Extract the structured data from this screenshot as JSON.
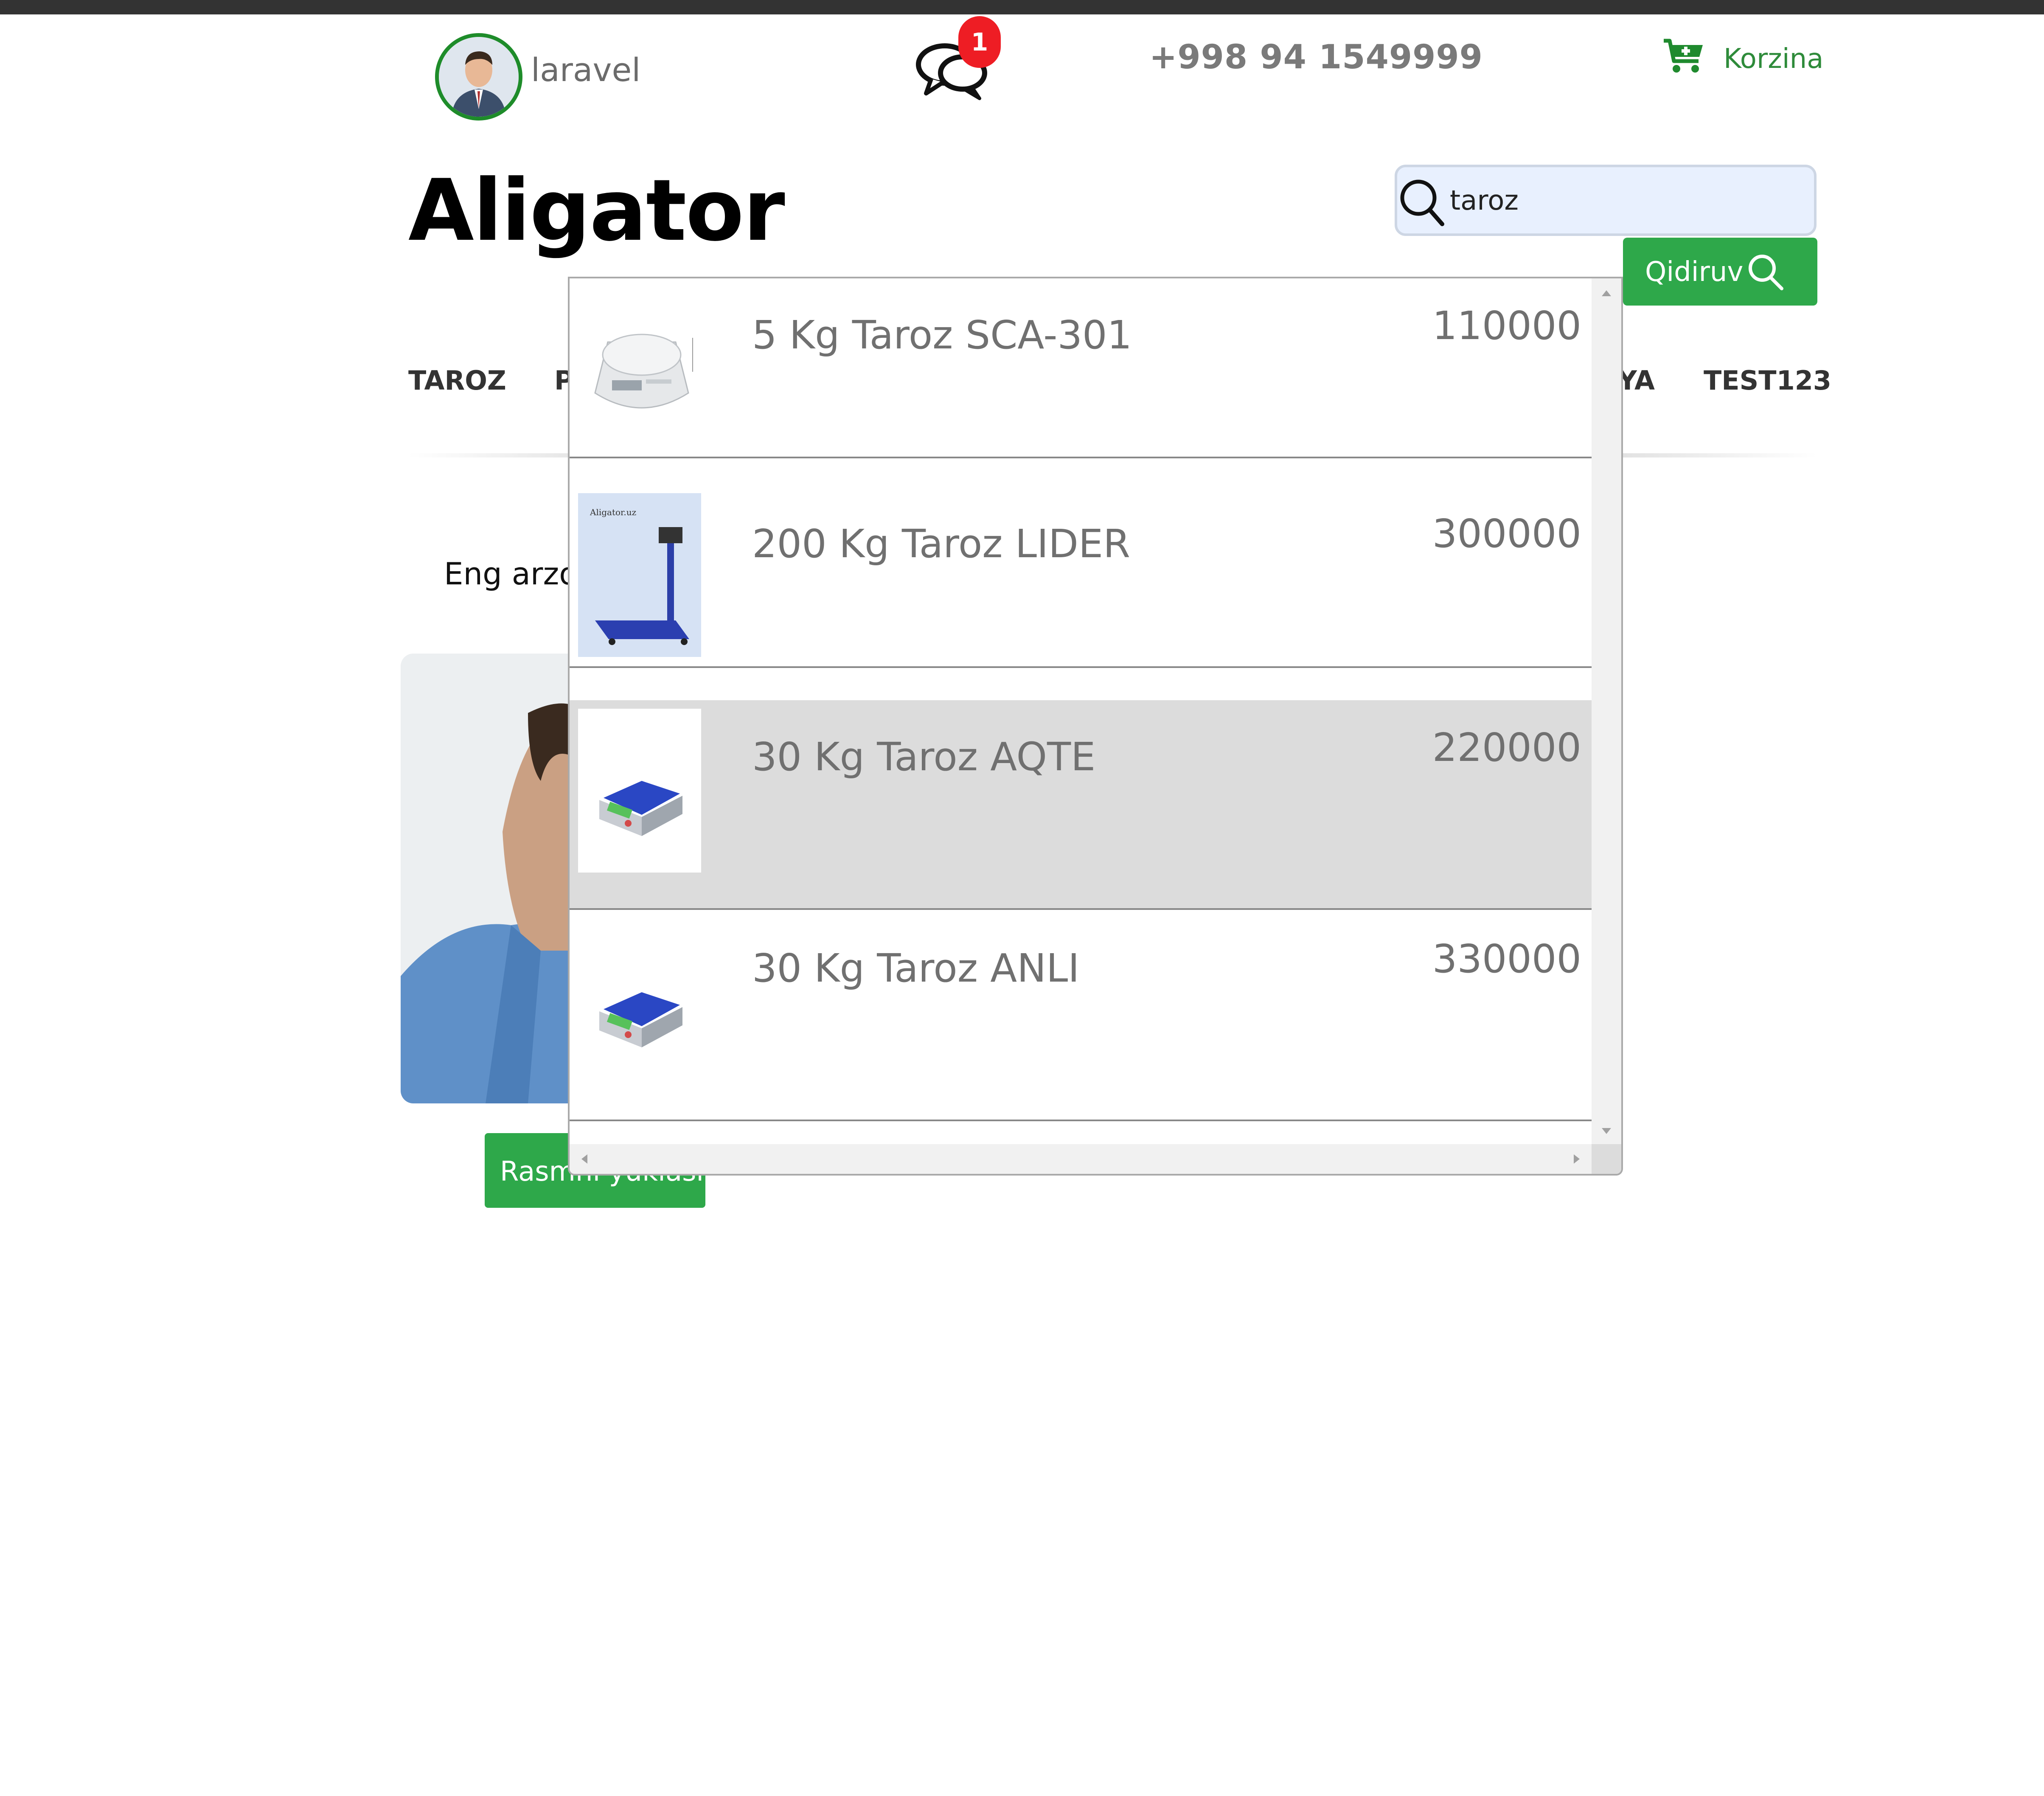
{
  "header": {
    "username": "laravel",
    "message_badge": "1",
    "phone": "+998 94 1549999",
    "cart_label": "Korzina"
  },
  "brand": "Aligator",
  "search": {
    "value": "taroz",
    "button_label": "Qidiruv"
  },
  "nav": {
    "items": [
      "TAROZ",
      "P",
      "YA",
      "TEST123"
    ]
  },
  "promo_text": "Eng arzo",
  "upload_button_label": "Rasmni yuklash",
  "results": [
    {
      "name": "5 Kg Taroz SCA-301",
      "price": "110000",
      "highlighted": false
    },
    {
      "name": "200 Kg Taroz LIDER",
      "price": "300000",
      "highlighted": false
    },
    {
      "name": "30 Kg Taroz AQTE",
      "price": "220000",
      "highlighted": true
    },
    {
      "name": "30 Kg Taroz ANLI",
      "price": "330000",
      "highlighted": false
    }
  ],
  "thumb_caption": "Aligator.uz",
  "colors": {
    "accent_green": "#2ea84a",
    "badge_red": "#ee1d24",
    "highlight_row": "#dcdcdc"
  }
}
